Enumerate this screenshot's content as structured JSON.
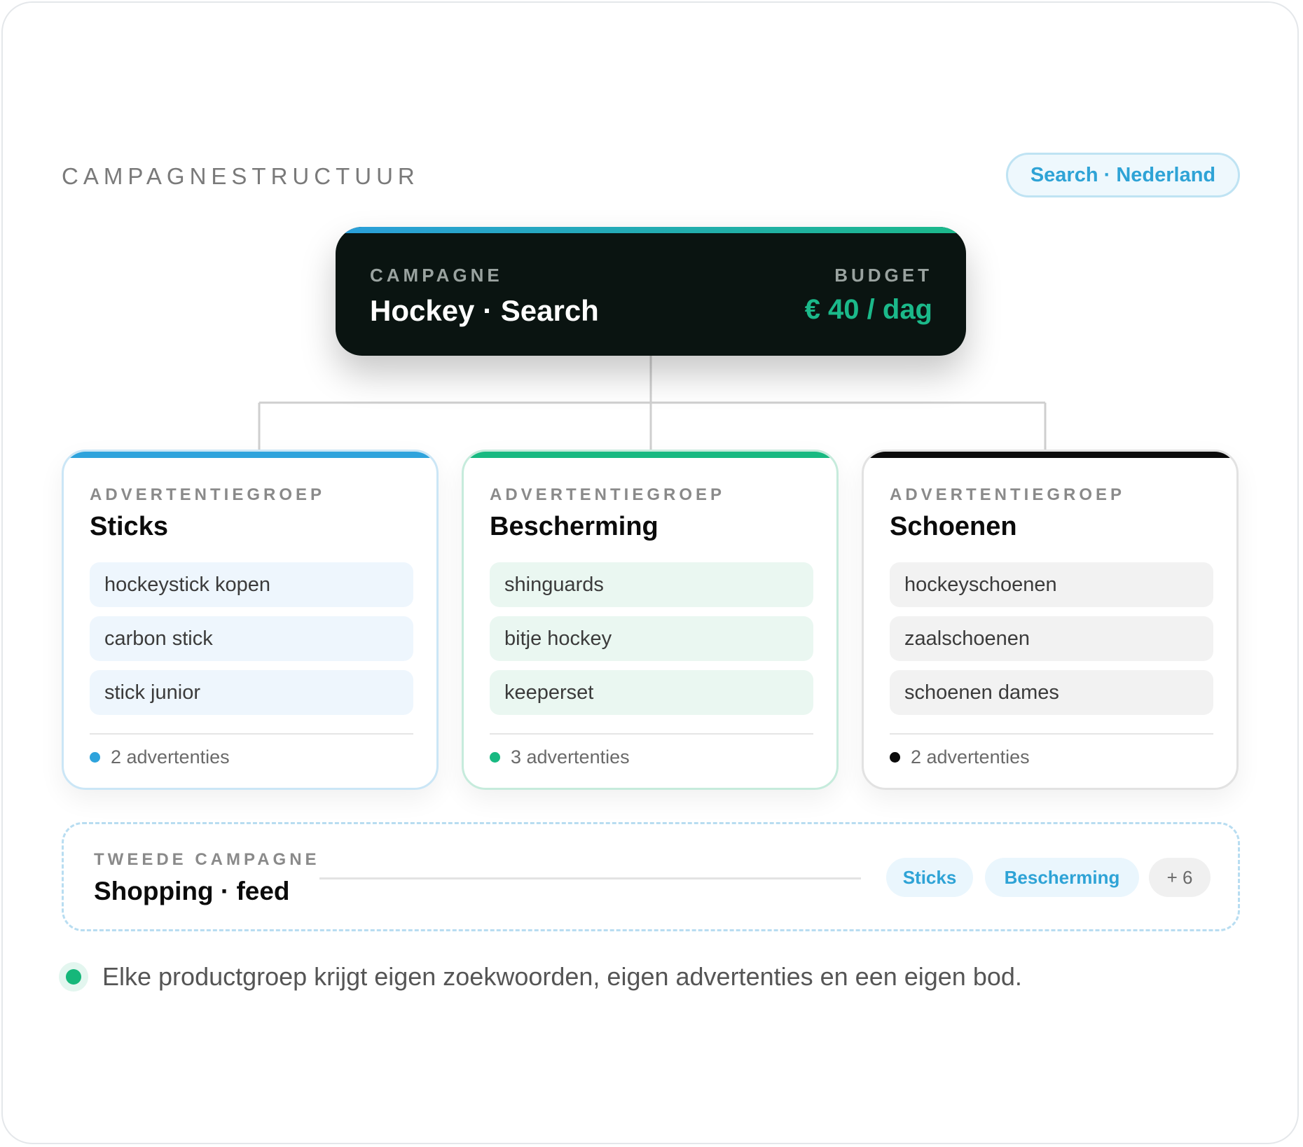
{
  "header": {
    "title": "CAMPAGNESTRUCTUUR",
    "badge": "Search · Nederland"
  },
  "campaign": {
    "label": "CAMPAGNE",
    "name": "Hockey · Search",
    "budget_label": "BUDGET",
    "budget_value": "€ 40 / dag"
  },
  "ad_groups": [
    {
      "label": "ADVERTENTIEGROEP",
      "name": "Sticks",
      "keywords": [
        "hockeystick kopen",
        "carbon stick",
        "stick junior"
      ],
      "ads": "2 advertenties",
      "accent": "#2ea3dc"
    },
    {
      "label": "ADVERTENTIEGROEP",
      "name": "Bescherming",
      "keywords": [
        "shinguards",
        "bitje hockey",
        "keeperset"
      ],
      "ads": "3 advertenties",
      "accent": "#18b981"
    },
    {
      "label": "ADVERTENTIEGROEP",
      "name": "Schoenen",
      "keywords": [
        "hockeyschoenen",
        "zaalschoenen",
        "schoenen dames"
      ],
      "ads": "2 advertenties",
      "accent": "#0b0b0b"
    }
  ],
  "second_campaign": {
    "label": "TWEEDE CAMPAGNE",
    "name": "Shopping · feed",
    "chips": [
      "Sticks",
      "Bescherming",
      "+ 6"
    ]
  },
  "note": {
    "text": "Elke productgroep krijgt eigen zoekwoorden, eigen advertenties en een eigen bod."
  }
}
